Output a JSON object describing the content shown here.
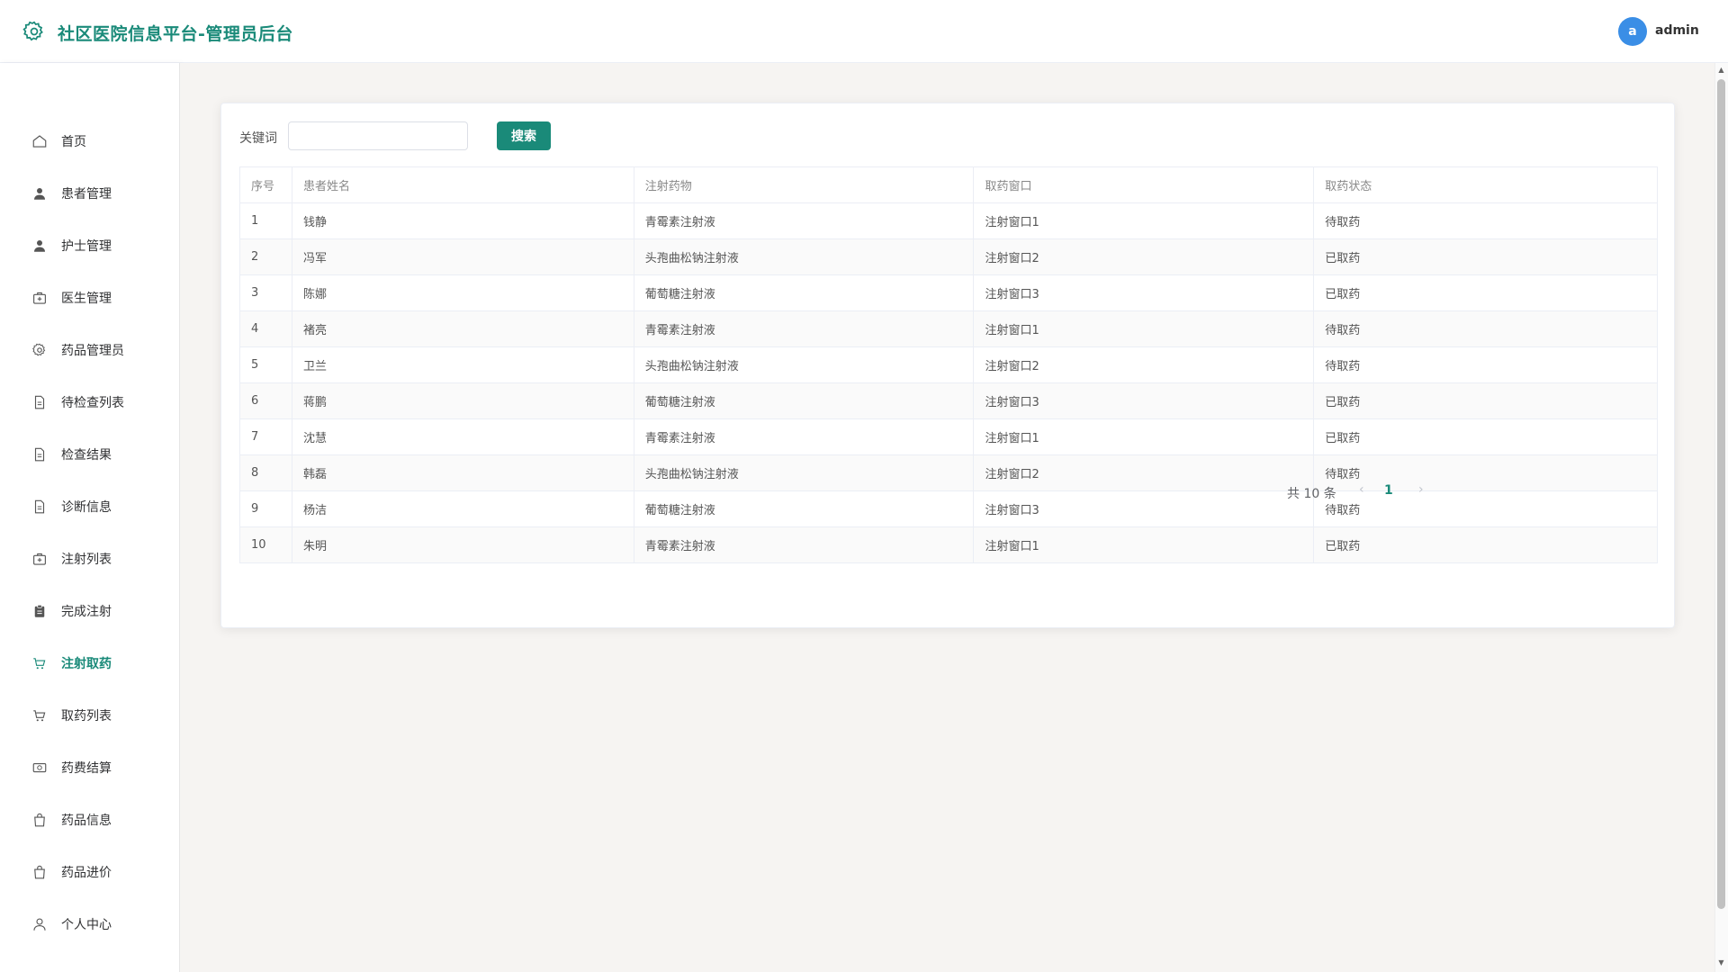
{
  "header": {
    "title": "社区医院信息平台-管理员后台",
    "avatar_letter": "a",
    "username": "admin"
  },
  "sidebar": {
    "items": [
      {
        "label": "首页",
        "icon": "home-icon"
      },
      {
        "label": "患者管理",
        "icon": "user-filled-icon"
      },
      {
        "label": "护士管理",
        "icon": "user-filled-icon"
      },
      {
        "label": "医生管理",
        "icon": "first-aid-kit-icon"
      },
      {
        "label": "药品管理员",
        "icon": "gear-icon"
      },
      {
        "label": "待检查列表",
        "icon": "document-icon"
      },
      {
        "label": "检查结果",
        "icon": "document-icon"
      },
      {
        "label": "诊断信息",
        "icon": "document-icon"
      },
      {
        "label": "注射列表",
        "icon": "first-aid-kit-icon"
      },
      {
        "label": "完成注射",
        "icon": "clipboard-icon"
      },
      {
        "label": "注射取药",
        "icon": "cart-icon"
      },
      {
        "label": "取药列表",
        "icon": "cart-icon"
      },
      {
        "label": "药费结算",
        "icon": "money-icon"
      },
      {
        "label": "药品信息",
        "icon": "bag-icon"
      },
      {
        "label": "药品进价",
        "icon": "bag-icon"
      },
      {
        "label": "个人中心",
        "icon": "user-icon"
      }
    ],
    "active_index": 10
  },
  "search": {
    "label": "关键词",
    "value": "",
    "placeholder": "",
    "button_label": "搜索"
  },
  "table": {
    "columns": [
      "序号",
      "患者姓名",
      "注射药物",
      "取药窗口",
      "取药状态"
    ],
    "rows": [
      [
        "1",
        "钱静",
        "青霉素注射液",
        "注射窗口1",
        "待取药"
      ],
      [
        "2",
        "冯军",
        "头孢曲松钠注射液",
        "注射窗口2",
        "已取药"
      ],
      [
        "3",
        "陈娜",
        "葡萄糖注射液",
        "注射窗口3",
        "已取药"
      ],
      [
        "4",
        "褚亮",
        "青霉素注射液",
        "注射窗口1",
        "待取药"
      ],
      [
        "5",
        "卫兰",
        "头孢曲松钠注射液",
        "注射窗口2",
        "待取药"
      ],
      [
        "6",
        "蒋鹏",
        "葡萄糖注射液",
        "注射窗口3",
        "已取药"
      ],
      [
        "7",
        "沈慧",
        "青霉素注射液",
        "注射窗口1",
        "已取药"
      ],
      [
        "8",
        "韩磊",
        "头孢曲松钠注射液",
        "注射窗口2",
        "待取药"
      ],
      [
        "9",
        "杨洁",
        "葡萄糖注射液",
        "注射窗口3",
        "待取药"
      ],
      [
        "10",
        "朱明",
        "青霉素注射液",
        "注射窗口1",
        "已取药"
      ]
    ]
  },
  "pagination": {
    "total_text": "共 10 条",
    "current_page": "1",
    "prev_symbol": "‹",
    "next_symbol": "›"
  },
  "colors": {
    "accent": "#1a8a79",
    "avatar_bg": "#3a8ee6",
    "content_bg": "#f6f4f2"
  }
}
